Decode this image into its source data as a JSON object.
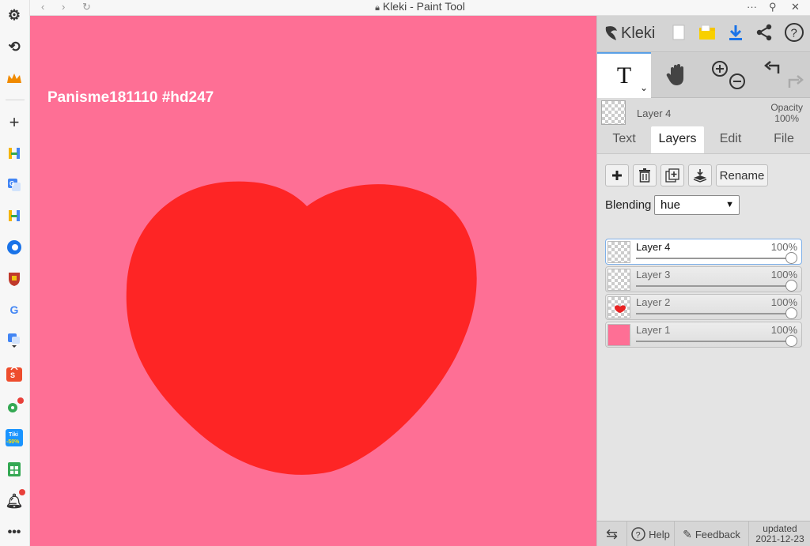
{
  "window": {
    "title": "Kleki - Paint Tool"
  },
  "canvas": {
    "text": "Panisme181110 #hd247",
    "background": "#fe6f95",
    "heart_color": "#fe2525"
  },
  "app": {
    "name": "Kleki"
  },
  "tools": {
    "text_label": "T"
  },
  "current_layer": {
    "name": "Layer 4",
    "opacity_label": "Opacity",
    "opacity_value": "100%"
  },
  "tabs": [
    {
      "label": "Text"
    },
    {
      "label": "Layers"
    },
    {
      "label": "Edit"
    },
    {
      "label": "File"
    }
  ],
  "layers_panel": {
    "rename_label": "Rename",
    "blending_label": "Blending",
    "blending_value": "hue",
    "layers": [
      {
        "name": "Layer 4",
        "opacity": "100%"
      },
      {
        "name": "Layer 3",
        "opacity": "100%"
      },
      {
        "name": "Layer 2",
        "opacity": "100%"
      },
      {
        "name": "Layer 1",
        "opacity": "100%"
      }
    ]
  },
  "bottom": {
    "help": "Help",
    "feedback": "Feedback",
    "updated_label": "updated",
    "updated_date": "2021-12-23"
  }
}
